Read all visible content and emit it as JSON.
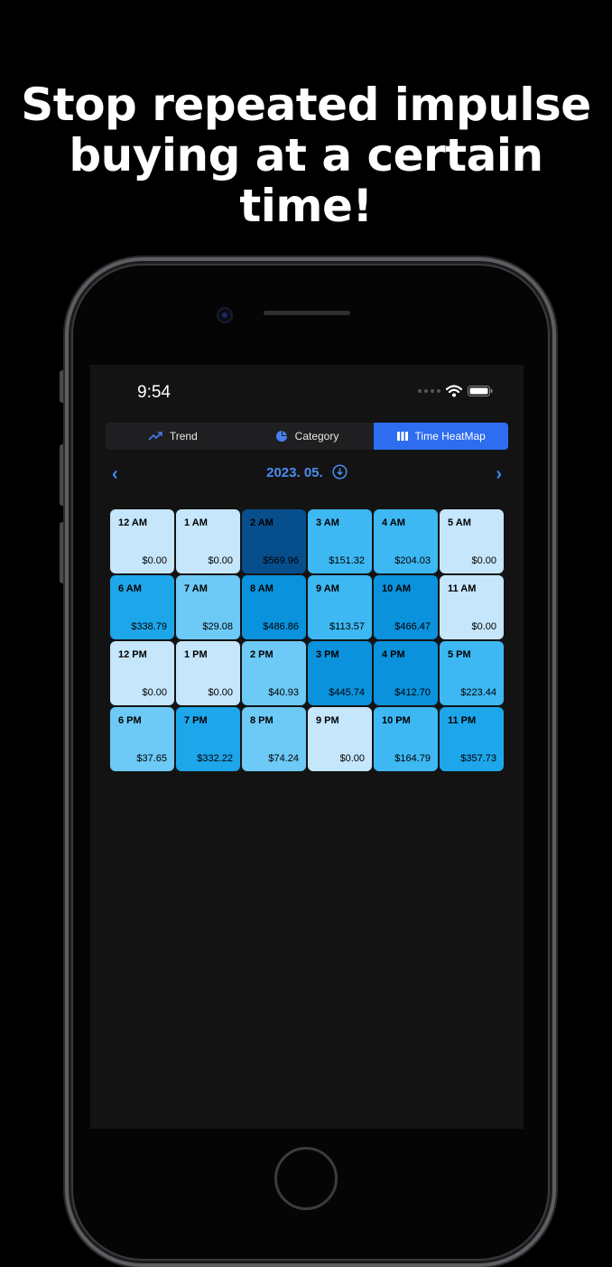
{
  "headline": {
    "line1": "Stop repeated impulse",
    "line2": "buying at a certain time!"
  },
  "status_bar": {
    "time": "9:54"
  },
  "tabs": [
    {
      "label": "Trend",
      "icon": "trend-line-icon",
      "active": false
    },
    {
      "label": "Category",
      "icon": "pie-chart-icon",
      "active": false
    },
    {
      "label": "Time HeatMap",
      "icon": "bar-columns-icon",
      "active": true
    }
  ],
  "month_nav": {
    "label": "2023. 05.",
    "prev_icon": "chevron-left-icon",
    "next_icon": "chevron-right-icon",
    "download_icon": "download-circle-icon"
  },
  "heatmap_colors": {
    "level0": "#c5e6fb",
    "level1": "#6dc9f6",
    "level2": "#3db8f2",
    "level3": "#1ea6ea",
    "level4": "#0a92dc",
    "level5": "#074e8d"
  },
  "accent_color": "#2e6cf0",
  "chart_data": {
    "type": "heatmap",
    "cells": [
      {
        "hour": "12 AM",
        "amount": "$0.00",
        "value": 0
      },
      {
        "hour": "1 AM",
        "amount": "$0.00",
        "value": 0
      },
      {
        "hour": "2 AM",
        "amount": "$569.96",
        "value": 569.96
      },
      {
        "hour": "3 AM",
        "amount": "$151.32",
        "value": 151.32
      },
      {
        "hour": "4 AM",
        "amount": "$204.03",
        "value": 204.03
      },
      {
        "hour": "5 AM",
        "amount": "$0.00",
        "value": 0
      },
      {
        "hour": "6 AM",
        "amount": "$338.79",
        "value": 338.79
      },
      {
        "hour": "7 AM",
        "amount": "$29.08",
        "value": 29.08
      },
      {
        "hour": "8 AM",
        "amount": "$486.86",
        "value": 486.86
      },
      {
        "hour": "9 AM",
        "amount": "$113.57",
        "value": 113.57
      },
      {
        "hour": "10 AM",
        "amount": "$466.47",
        "value": 466.47
      },
      {
        "hour": "11 AM",
        "amount": "$0.00",
        "value": 0
      },
      {
        "hour": "12 PM",
        "amount": "$0.00",
        "value": 0
      },
      {
        "hour": "1 PM",
        "amount": "$0.00",
        "value": 0
      },
      {
        "hour": "2 PM",
        "amount": "$40.93",
        "value": 40.93
      },
      {
        "hour": "3 PM",
        "amount": "$445.74",
        "value": 445.74
      },
      {
        "hour": "4 PM",
        "amount": "$412.70",
        "value": 412.7
      },
      {
        "hour": "5 PM",
        "amount": "$223.44",
        "value": 223.44
      },
      {
        "hour": "6 PM",
        "amount": "$37.65",
        "value": 37.65
      },
      {
        "hour": "7 PM",
        "amount": "$332.22",
        "value": 332.22
      },
      {
        "hour": "8 PM",
        "amount": "$74.24",
        "value": 74.24
      },
      {
        "hour": "9 PM",
        "amount": "$0.00",
        "value": 0
      },
      {
        "hour": "10 PM",
        "amount": "$164.79",
        "value": 164.79
      },
      {
        "hour": "11 PM",
        "amount": "$357.73",
        "value": 357.73
      }
    ]
  }
}
